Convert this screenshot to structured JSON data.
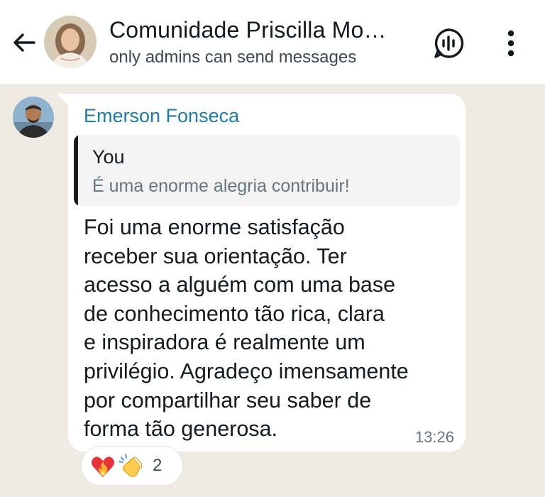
{
  "header": {
    "title": "Comunidade Priscilla Mo…",
    "subtitle": "only admins can send messages",
    "back_icon": "arrow-left-icon",
    "voice_icon": "voice-chat-icon",
    "menu_icon": "more-vertical-icon"
  },
  "message": {
    "sender": "Emerson Fonseca",
    "quote_author": "You",
    "quote_text": "É uma enorme alegria contribuir!",
    "lines": [
      "Foi uma enorme satisfação",
      "receber sua orientação. Ter",
      "acesso a alguém com uma base",
      "de conhecimento tão rica, clara",
      "e inspiradora é realmente um",
      "privilégio. Agradeço imensamente",
      "por compartilhar seu saber de",
      "forma tão generosa."
    ],
    "time": "13:26"
  },
  "reactions": {
    "emojis": [
      "heart-on-fire",
      "clapping-hands"
    ],
    "count": "2"
  },
  "colors": {
    "chat_background": "#efeae2",
    "sender_name": "#1f7aa8",
    "bubble": "#ffffff"
  }
}
